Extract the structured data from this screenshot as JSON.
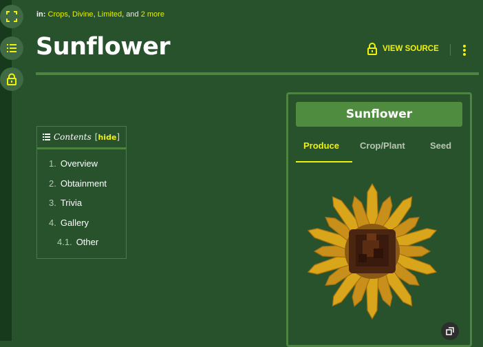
{
  "categories": {
    "prefix": "in:",
    "links": [
      "Crops",
      "Divine",
      "Limited"
    ],
    "separator": ",",
    "and_text": "and",
    "more_link": "2 more"
  },
  "page": {
    "title": "Sunflower"
  },
  "header": {
    "view_source": "VIEW SOURCE"
  },
  "toc": {
    "title": "Contents",
    "hide_label": "hide",
    "items": [
      {
        "num": "1.",
        "label": "Overview"
      },
      {
        "num": "2.",
        "label": "Obtainment"
      },
      {
        "num": "3.",
        "label": "Trivia"
      },
      {
        "num": "4.",
        "label": "Gallery"
      },
      {
        "num": "4.1.",
        "label": "Other"
      }
    ]
  },
  "infobox": {
    "title": "Sunflower",
    "tabs": [
      "Produce",
      "Crop/Plant",
      "Seed"
    ],
    "active_tab": "Produce"
  },
  "icons": {
    "rail": [
      "fullscreen-icon",
      "list-icon",
      "lock-icon"
    ],
    "view_source": "lock-icon",
    "more": "kebab-menu-icon",
    "expand": "expand-image-icon"
  },
  "colors": {
    "background": "#27522c",
    "accent": "#f1f20b",
    "rail": "#163a1b",
    "rule": "#4d8440"
  }
}
